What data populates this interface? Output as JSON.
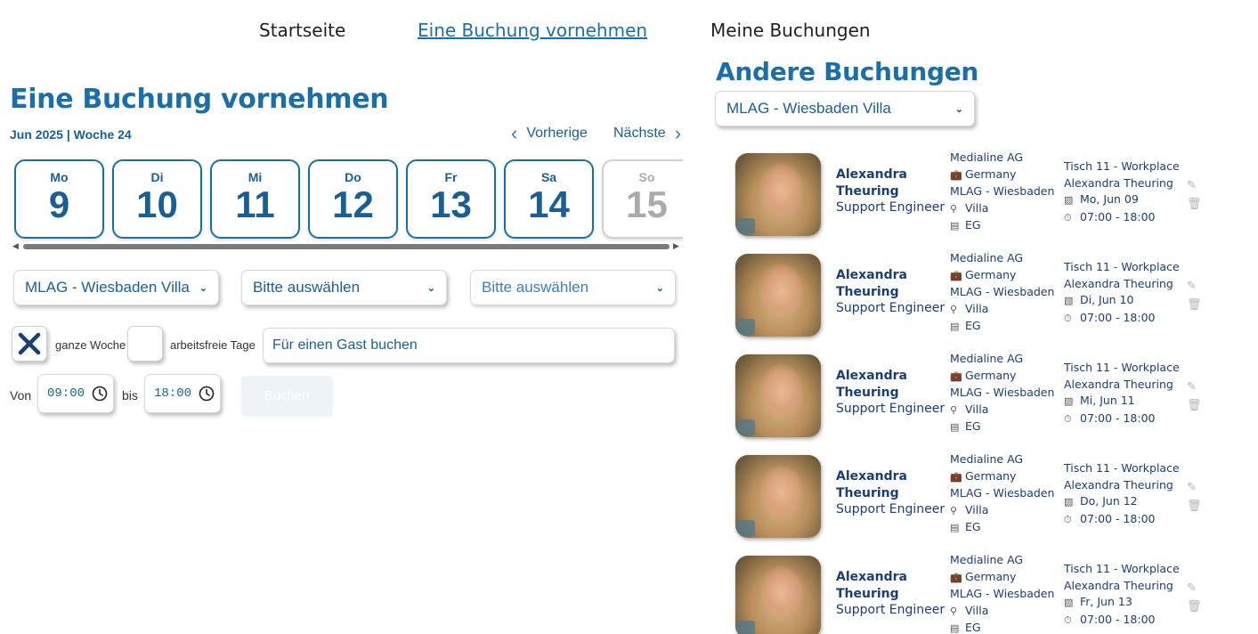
{
  "nav": {
    "home": "Startseite",
    "book": "Eine Buchung vornehmen",
    "my_bookings": "Meine Buchungen"
  },
  "booking_form": {
    "title": "Eine Buchung vornehmen",
    "week_label": "Jun 2025 | Woche 24",
    "prev_label": "Vorherige",
    "next_label": "Nächste",
    "days": [
      {
        "name": "Mo",
        "num": "9",
        "available": true
      },
      {
        "name": "Di",
        "num": "10",
        "available": true
      },
      {
        "name": "Mi",
        "num": "11",
        "available": true
      },
      {
        "name": "Do",
        "num": "12",
        "available": true
      },
      {
        "name": "Fr",
        "num": "13",
        "available": true
      },
      {
        "name": "Sa",
        "num": "14",
        "available": true
      },
      {
        "name": "So",
        "num": "15",
        "available": false
      }
    ],
    "location_select": "MLAG - Wiesbaden Villa",
    "floor_select": "Bitte auswählen",
    "room_select": "Bitte auswählen",
    "whole_week_checked": true,
    "whole_week_label": "ganze Woche",
    "non_working_checked": false,
    "non_working_label": "arbeitsfreie Tage",
    "guest_placeholder": "Für einen Gast buchen",
    "from_label": "Von",
    "from_time": "09:00",
    "to_label": "bis",
    "to_time": "18:00",
    "submit_label": "Buchen"
  },
  "other_bookings": {
    "title": "Andere Buchungen",
    "location_filter": "MLAG - Wiesbaden Villa",
    "items": [
      {
        "first_name": "Alexandra",
        "last_name": "Theuring",
        "role": "Support Engineer",
        "company": "Medialine AG",
        "country": "Germany",
        "site": "MLAG - Wiesbaden",
        "building": "Villa",
        "floor": "EG",
        "desk": "Tisch 11 - Workplace",
        "booked_by": "Alexandra Theuring",
        "date": "Mo, Jun 09",
        "time": "07:00 - 18:00"
      },
      {
        "first_name": "Alexandra",
        "last_name": "Theuring",
        "role": "Support Engineer",
        "company": "Medialine AG",
        "country": "Germany",
        "site": "MLAG - Wiesbaden",
        "building": "Villa",
        "floor": "EG",
        "desk": "Tisch 11 - Workplace",
        "booked_by": "Alexandra Theuring",
        "date": "Di, Jun 10",
        "time": "07:00 - 18:00"
      },
      {
        "first_name": "Alexandra",
        "last_name": "Theuring",
        "role": "Support Engineer",
        "company": "Medialine AG",
        "country": "Germany",
        "site": "MLAG - Wiesbaden",
        "building": "Villa",
        "floor": "EG",
        "desk": "Tisch 11 - Workplace",
        "booked_by": "Alexandra Theuring",
        "date": "Mi, Jun 11",
        "time": "07:00 - 18:00"
      },
      {
        "first_name": "Alexandra",
        "last_name": "Theuring",
        "role": "Support Engineer",
        "company": "Medialine AG",
        "country": "Germany",
        "site": "MLAG - Wiesbaden",
        "building": "Villa",
        "floor": "EG",
        "desk": "Tisch 11 - Workplace",
        "booked_by": "Alexandra Theuring",
        "date": "Do, Jun 12",
        "time": "07:00 - 18:00"
      },
      {
        "first_name": "Alexandra",
        "last_name": "Theuring",
        "role": "Support Engineer",
        "company": "Medialine AG",
        "country": "Germany",
        "site": "MLAG - Wiesbaden",
        "building": "Villa",
        "floor": "EG",
        "desk": "Tisch 11 - Workplace",
        "booked_by": "Alexandra Theuring",
        "date": "Fr, Jun 13",
        "time": "07:00 - 18:00"
      }
    ]
  },
  "colors": {
    "accent": "#1a6fa8",
    "dark_blue": "#1a3e75",
    "muted_icon": "#b5b5b5"
  }
}
